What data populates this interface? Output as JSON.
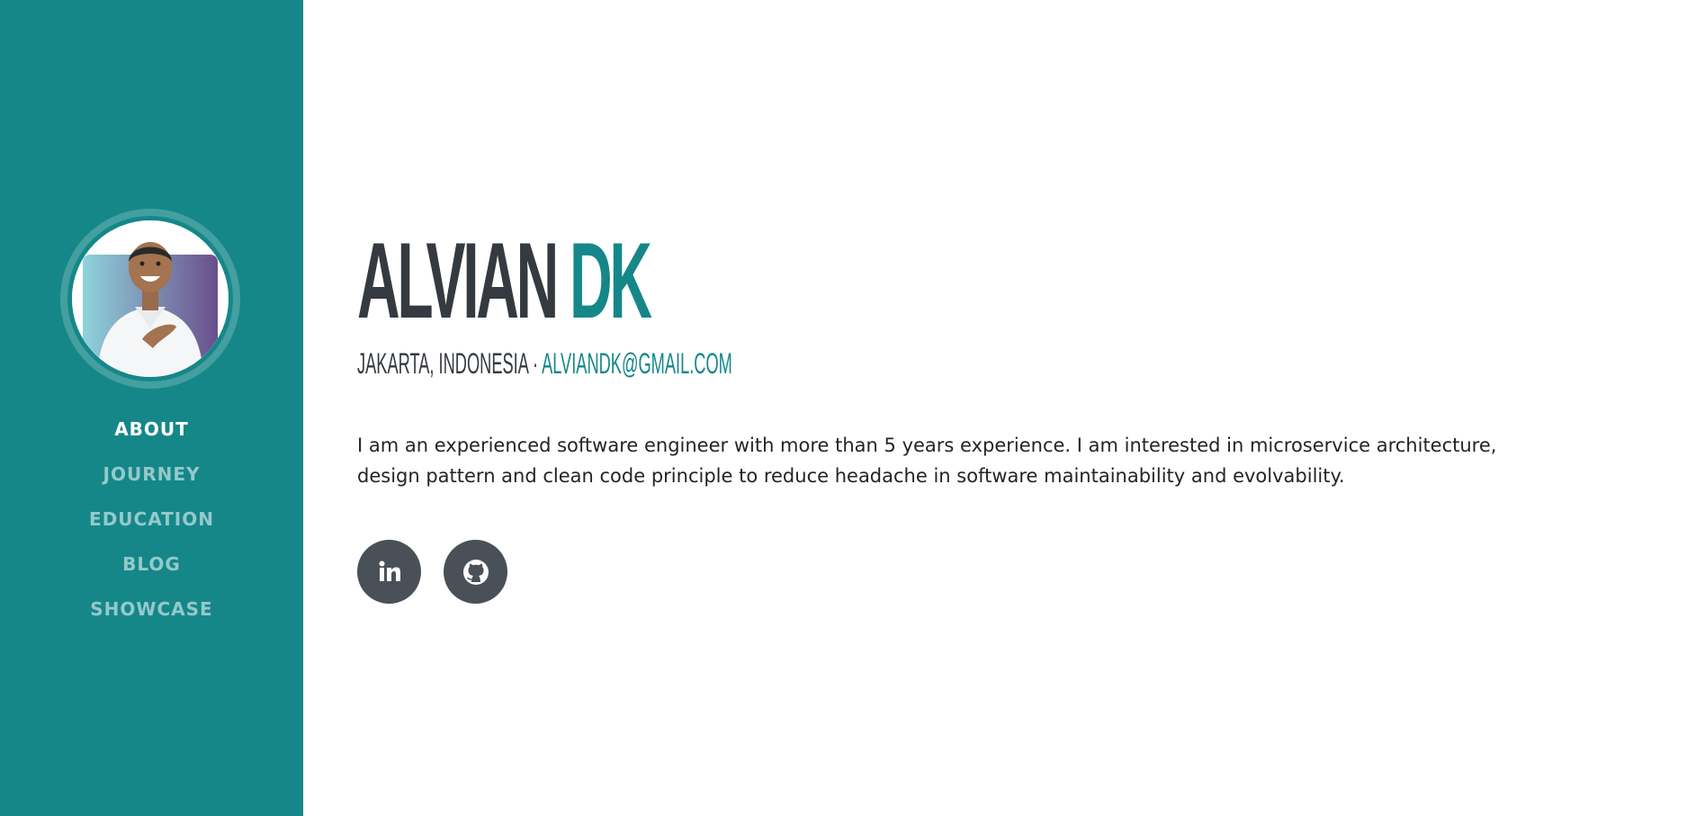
{
  "sidebar": {
    "nav_items": [
      {
        "label": "ABOUT"
      },
      {
        "label": "JOURNEY"
      },
      {
        "label": "EDUCATION"
      },
      {
        "label": "BLOG"
      },
      {
        "label": "SHOWCASE"
      }
    ],
    "active_index": 0
  },
  "main": {
    "first_name": "ALVIAN",
    "last_name": "DK",
    "location": "JAKARTA, INDONESIA",
    "separator": "·",
    "email": "ALVIANDK@GMAIL.COM",
    "lead": "I am an experienced software engineer with more than 5 years experience. I am interested in microservice architecture, design pattern and clean code principle to reduce headache in software maintainability and evolvability."
  },
  "social_links": {
    "linkedin_icon": "linkedin-icon",
    "github_icon": "github-icon"
  },
  "colors": {
    "primary": "#158789",
    "dark": "#343a40",
    "social_bg": "#495057",
    "text": "#212529"
  }
}
